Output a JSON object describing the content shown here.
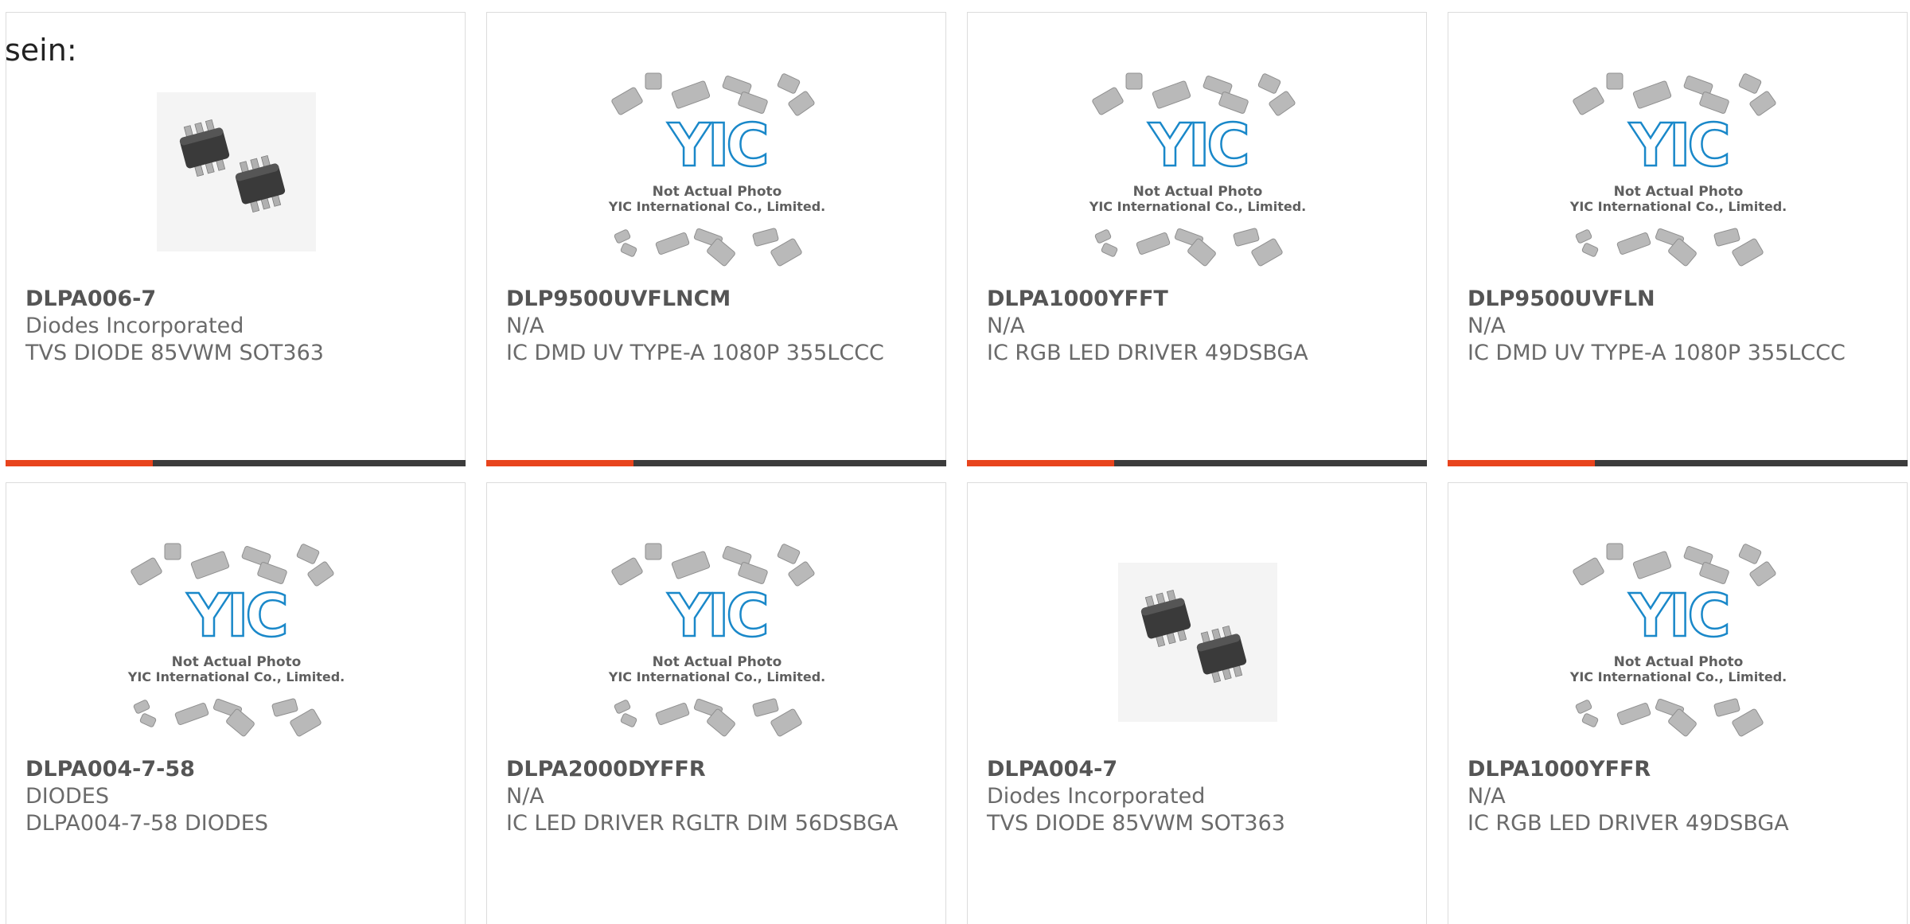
{
  "lead_text": "sein:",
  "brand": {
    "accent_color": "#e8441d",
    "bar_color": "#3c3c3c",
    "logo_color": "#1a88c9"
  },
  "placeholder": {
    "logo": "YIC",
    "line1": "Not Actual Photo",
    "line2": "YIC International Co., Limited."
  },
  "products": [
    {
      "part": "DLPA006-7",
      "manufacturer": "Diodes Incorporated",
      "description": "TVS DIODE 85VWM SOT363",
      "image": "sot363-photo",
      "progress": 0.32
    },
    {
      "part": "DLP9500UVFLNCM",
      "manufacturer": "N/A",
      "description": "IC DMD UV TYPE-A 1080P 355LCCC",
      "image": "yic-placeholder",
      "progress": 0.32
    },
    {
      "part": "DLPA1000YFFT",
      "manufacturer": "N/A",
      "description": "IC RGB LED DRIVER 49DSBGA",
      "image": "yic-placeholder",
      "progress": 0.32
    },
    {
      "part": "DLP9500UVFLN",
      "manufacturer": "N/A",
      "description": "IC DMD UV TYPE-A 1080P 355LCCC",
      "image": "yic-placeholder",
      "progress": 0.32
    },
    {
      "part": "DLPA004-7-58",
      "manufacturer": "DIODES",
      "description": "DLPA004-7-58 DIODES",
      "image": "yic-placeholder",
      "progress": 0
    },
    {
      "part": "DLPA2000DYFFR",
      "manufacturer": "N/A",
      "description": "IC LED DRIVER RGLTR DIM 56DSBGA",
      "image": "yic-placeholder",
      "progress": 0
    },
    {
      "part": "DLPA004-7",
      "manufacturer": "Diodes Incorporated",
      "description": "TVS DIODE 85VWM SOT363",
      "image": "sot363-photo",
      "progress": 0
    },
    {
      "part": "DLPA1000YFFR",
      "manufacturer": "N/A",
      "description": "IC RGB LED DRIVER 49DSBGA",
      "image": "yic-placeholder",
      "progress": 0
    }
  ]
}
